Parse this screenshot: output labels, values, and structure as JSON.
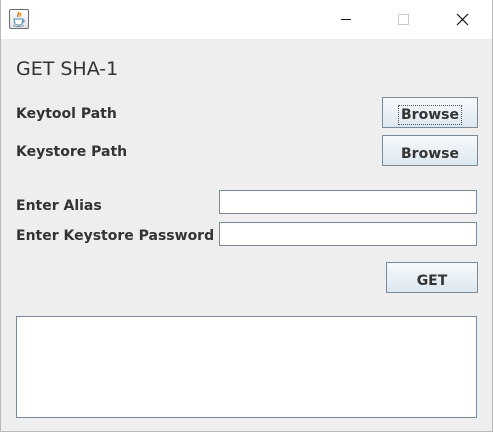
{
  "window": {
    "icon": "java-icon",
    "controls": {
      "minimize_icon": "minimize-icon",
      "maximize_icon": "maximize-icon",
      "close_icon": "close-icon"
    }
  },
  "main": {
    "title": "GET SHA-1",
    "keytool": {
      "label": "Keytool Path",
      "button_label": "Browse"
    },
    "keystore": {
      "label": "Keystore Path",
      "button_label": "Browse"
    },
    "alias": {
      "label": "Enter Alias",
      "value": ""
    },
    "password": {
      "label": "Enter Keystore Password",
      "value": ""
    },
    "get_button_label": "GET",
    "output": {
      "value": ""
    }
  },
  "colors": {
    "window_background": "#eeeeee",
    "titlebar_background": "#ffffff",
    "button_border": "#7a8a99",
    "text": "#333333"
  }
}
